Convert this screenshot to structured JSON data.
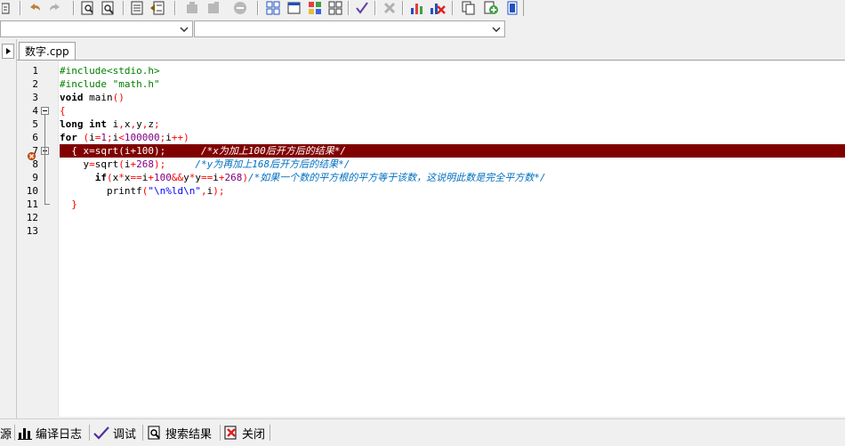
{
  "tabs": [
    {
      "label": "数字.cpp"
    }
  ],
  "editor": {
    "line_numbers": [
      "1",
      "2",
      "3",
      "4",
      "5",
      "6",
      "7",
      "8",
      "9",
      "10",
      "11",
      "12",
      "13"
    ],
    "lines": [
      [
        {
          "t": "pp",
          "v": "#include<stdio.h>"
        }
      ],
      [
        {
          "t": "pp",
          "v": "#include \"math.h\""
        }
      ],
      [
        {
          "t": "kw",
          "v": "void"
        },
        {
          "t": "plain",
          "v": " main"
        },
        {
          "t": "sym",
          "v": "()"
        }
      ],
      [
        {
          "t": "sym",
          "v": "{"
        }
      ],
      [
        {
          "t": "kw",
          "v": "long int"
        },
        {
          "t": "plain",
          "v": " i"
        },
        {
          "t": "sym",
          "v": ","
        },
        {
          "t": "plain",
          "v": "x"
        },
        {
          "t": "sym",
          "v": ","
        },
        {
          "t": "plain",
          "v": "y"
        },
        {
          "t": "sym",
          "v": ","
        },
        {
          "t": "plain",
          "v": "z"
        },
        {
          "t": "sym",
          "v": ";"
        }
      ],
      [
        {
          "t": "kw",
          "v": "for"
        },
        {
          "t": "plain",
          "v": " "
        },
        {
          "t": "sym",
          "v": "("
        },
        {
          "t": "plain",
          "v": "i"
        },
        {
          "t": "sym",
          "v": "="
        },
        {
          "t": "num",
          "v": "1"
        },
        {
          "t": "sym",
          "v": ";"
        },
        {
          "t": "plain",
          "v": "i"
        },
        {
          "t": "sym",
          "v": "<"
        },
        {
          "t": "num",
          "v": "100000"
        },
        {
          "t": "sym",
          "v": ";"
        },
        {
          "t": "plain",
          "v": "i"
        },
        {
          "t": "sym",
          "v": "++)"
        }
      ],
      [
        {
          "t": "plain",
          "v": "  "
        },
        {
          "t": "sym",
          "v": "{"
        },
        {
          "t": "plain",
          "v": " x"
        },
        {
          "t": "sym",
          "v": "="
        },
        {
          "t": "plain",
          "v": "sqrt"
        },
        {
          "t": "sym",
          "v": "("
        },
        {
          "t": "plain",
          "v": "i"
        },
        {
          "t": "sym",
          "v": "+"
        },
        {
          "t": "num",
          "v": "100"
        },
        {
          "t": "sym",
          "v": ");"
        },
        {
          "t": "plain",
          "v": "      "
        },
        {
          "t": "cm",
          "v": "/*x为加上100后开方后的结果*/"
        }
      ],
      [
        {
          "t": "plain",
          "v": "    y"
        },
        {
          "t": "sym",
          "v": "="
        },
        {
          "t": "plain",
          "v": "sqrt"
        },
        {
          "t": "sym",
          "v": "("
        },
        {
          "t": "plain",
          "v": "i"
        },
        {
          "t": "sym",
          "v": "+"
        },
        {
          "t": "num",
          "v": "268"
        },
        {
          "t": "sym",
          "v": ");"
        },
        {
          "t": "plain",
          "v": "     "
        },
        {
          "t": "cm",
          "v": "/*y为再加上168后开方后的结果*/"
        }
      ],
      [
        {
          "t": "plain",
          "v": "      "
        },
        {
          "t": "kw",
          "v": "if"
        },
        {
          "t": "sym",
          "v": "("
        },
        {
          "t": "plain",
          "v": "x"
        },
        {
          "t": "sym",
          "v": "*"
        },
        {
          "t": "plain",
          "v": "x"
        },
        {
          "t": "sym",
          "v": "=="
        },
        {
          "t": "plain",
          "v": "i"
        },
        {
          "t": "sym",
          "v": "+"
        },
        {
          "t": "num",
          "v": "100"
        },
        {
          "t": "sym",
          "v": "&&"
        },
        {
          "t": "plain",
          "v": "y"
        },
        {
          "t": "sym",
          "v": "*"
        },
        {
          "t": "plain",
          "v": "y"
        },
        {
          "t": "sym",
          "v": "=="
        },
        {
          "t": "plain",
          "v": "i"
        },
        {
          "t": "sym",
          "v": "+"
        },
        {
          "t": "num",
          "v": "268"
        },
        {
          "t": "sym",
          "v": ")"
        },
        {
          "t": "cm",
          "v": "/*如果一个数的平方根的平方等于该数，这说明此数是完全平方数*/"
        }
      ],
      [
        {
          "t": "plain",
          "v": "        printf"
        },
        {
          "t": "sym",
          "v": "("
        },
        {
          "t": "str",
          "v": "\"\\n%ld\\n\""
        },
        {
          "t": "sym",
          "v": ","
        },
        {
          "t": "plain",
          "v": "i"
        },
        {
          "t": "sym",
          "v": ");"
        }
      ],
      [
        {
          "t": "plain",
          "v": "  "
        },
        {
          "t": "sym",
          "v": "}"
        }
      ],
      [],
      []
    ],
    "highlighted_line": 7,
    "error_line": 7
  },
  "status_tabs": [
    {
      "label": "源"
    },
    {
      "label": "编译日志"
    },
    {
      "label": "调试"
    },
    {
      "label": "搜索结果"
    },
    {
      "label": "关闭"
    }
  ],
  "colors": {
    "highlight": "#800000",
    "preprocessor": "#008000",
    "comment": "#0070c0",
    "string": "#0000ff",
    "number": "#800080",
    "symbol": "#ff0000"
  }
}
